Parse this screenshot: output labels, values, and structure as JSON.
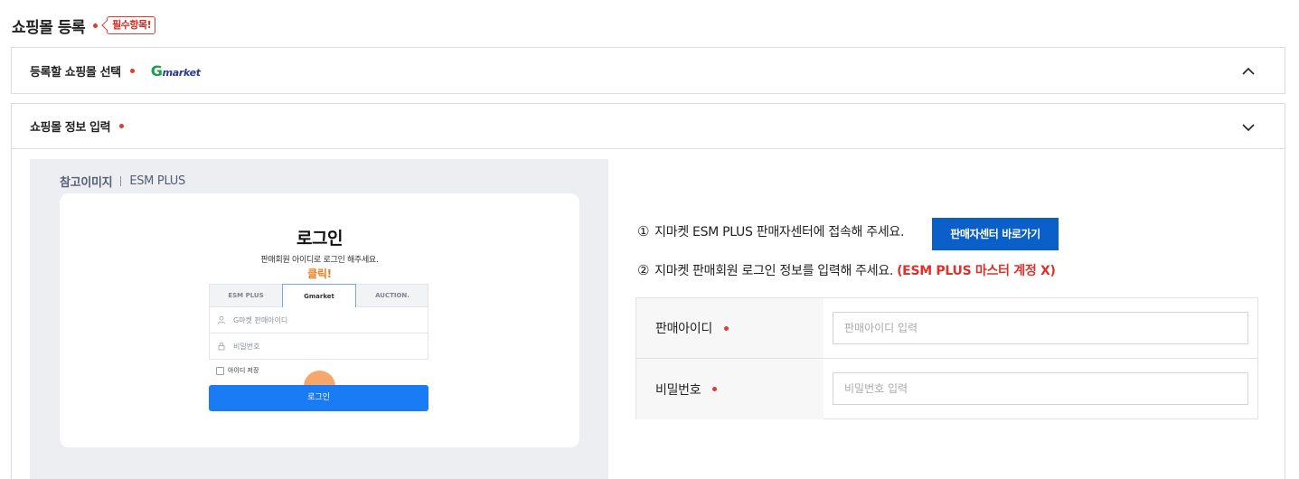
{
  "page": {
    "title": "쇼핑몰 등록",
    "required_badge": "필수항목!",
    "colors": {
      "accent": "#0a5fc8",
      "required": "#e03b30",
      "reference_bg": "#eceef2"
    }
  },
  "section1": {
    "label": "등록할 쇼핑몰 선택",
    "selected_mall": {
      "logo_g": "G",
      "logo_rest": "market"
    },
    "chevron": "chevron-up-icon"
  },
  "section2": {
    "label": "쇼핑몰 정보 입력",
    "chevron": "chevron-down-icon",
    "reference": {
      "caption_bold": "참고이미지",
      "caption_rest": "ESM PLUS",
      "mock": {
        "title": "로그인",
        "subtitle": "판매회원 아이디로 로그인 해주세요.",
        "click_hint": "클릭!",
        "tabs": [
          "ESM PLUS",
          "Gmarket",
          "AUCTION."
        ],
        "id_placeholder": "G마켓 판매아이디",
        "pw_placeholder": "비밀번호",
        "save_id": "아이디 저장",
        "login_button": "로그인"
      }
    },
    "steps": {
      "step1_num": "①",
      "step1_text": "지마켓 ESM PLUS 판매자센터에 접속해 주세요.",
      "step1_button": "판매자센터 바로가기",
      "step2_num": "②",
      "step2_text": "지마켓 판매회원 로그인 정보를 입력해 주세요.",
      "step2_warning": "(ESM PLUS 마스터 계정 X)"
    },
    "form": {
      "seller_id_label": "판매아이디",
      "seller_id_placeholder": "판매아이디 입력",
      "password_label": "비밀번호",
      "password_placeholder": "비밀번호 입력"
    }
  }
}
